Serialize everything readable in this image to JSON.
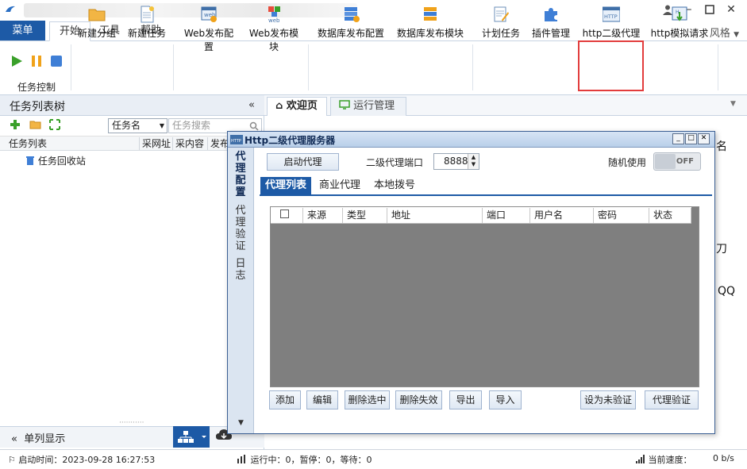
{
  "header": {
    "menu_label": "菜单",
    "tabs": [
      "开始",
      "工具",
      "帮助"
    ],
    "style_label": "风格"
  },
  "ribbon": {
    "task_control_label": "任务控制",
    "buttons": [
      "新建分组",
      "新建任务",
      "Web发布配置",
      "Web发布模块",
      "数据库发布配置",
      "数据库发布模块",
      "计划任务",
      "插件管理",
      "http二级代理",
      "http模拟请求"
    ]
  },
  "left_panel": {
    "title": "任务列表树",
    "search_kind": "任务名",
    "search_placeholder": "任务搜索",
    "columns": [
      "任务列表",
      "采网址",
      "采内容",
      "发布"
    ],
    "items": [
      "任务回收站"
    ],
    "footer_label": "单列显示"
  },
  "doc_tabs": [
    "欢迎页",
    "运行管理"
  ],
  "background_fragments": [
    "名",
    "刀",
    "QQ"
  ],
  "dialog": {
    "title": "Http二级代理服务器",
    "side_tabs": [
      "代理配置",
      "代理验证",
      "日志"
    ],
    "start_button": "启动代理",
    "port_label": "二级代理端口",
    "port_value": "8888",
    "random_label": "随机使用",
    "toggle_state": "OFF",
    "tabs": [
      "代理列表",
      "商业代理",
      "本地拨号"
    ],
    "grid_columns": [
      "来源",
      "类型",
      "地址",
      "端口",
      "用户名",
      "密码",
      "状态"
    ],
    "buttons_left": [
      "添加",
      "编辑",
      "删除选中",
      "删除失效",
      "导出",
      "导入"
    ],
    "buttons_right": [
      "设为未验证",
      "代理验证"
    ]
  },
  "status": {
    "start_time": "启动时间：2023-09-28 16:27:53",
    "running": "运行中：0，暂停：0，等待：0",
    "speed_label": "当前速度：",
    "speed_value": "0 b/s"
  },
  "colors": {
    "accent": "#1d5aa6",
    "highlight": "#e23c3c",
    "grid_bg": "#7f7f7f"
  }
}
